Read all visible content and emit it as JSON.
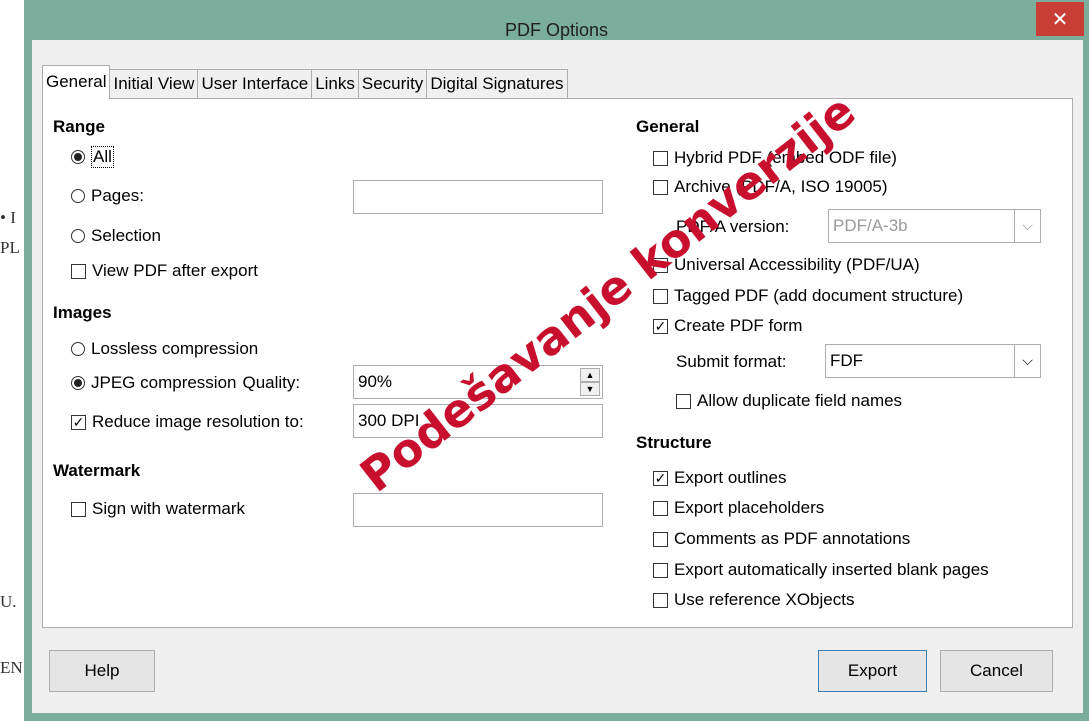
{
  "background_text": [
    "• I",
    "PL",
    "U.",
    "EN"
  ],
  "window": {
    "title": "PDF Options",
    "close_label": "✕"
  },
  "tabs": [
    "General",
    "Initial View",
    "User Interface",
    "Links",
    "Security",
    "Digital Signatures"
  ],
  "left": {
    "range": {
      "title": "Range",
      "all": "All",
      "pages": "Pages:",
      "pages_value": "",
      "selection": "Selection",
      "view_pdf": "View PDF after export"
    },
    "images": {
      "title": "Images",
      "lossless": "Lossless compression",
      "jpeg": "JPEG compression",
      "quality_label": "Quality:",
      "quality_value": "90%",
      "reduce": "Reduce image resolution to:",
      "resolution_value": "300 DPI"
    },
    "watermark": {
      "title": "Watermark",
      "sign": "Sign with watermark",
      "value": ""
    }
  },
  "right": {
    "general": {
      "title": "General",
      "hybrid": "Hybrid PDF (embed ODF file)",
      "archive": "Archive (PDF/A, ISO 19005)",
      "pdfa_label": "PDF/A version:",
      "pdfa_value": "PDF/A-3b",
      "universal": "Universal Accessibility (PDF/UA)",
      "tagged": "Tagged PDF (add document structure)",
      "create_form": "Create PDF form",
      "submit_label": "Submit format:",
      "submit_value": "FDF",
      "allow_duplicate": "Allow duplicate field names"
    },
    "structure": {
      "title": "Structure",
      "outlines": "Export outlines",
      "placeholders": "Export placeholders",
      "comments": "Comments as PDF annotations",
      "blank_pages": "Export automatically inserted blank pages",
      "xobjects": "Use reference XObjects"
    }
  },
  "buttons": {
    "help": "Help",
    "export": "Export",
    "cancel": "Cancel"
  },
  "overlay_text": "Podešavanje konverzije",
  "colors": {
    "title_bar": "#7bad9d",
    "close_button": "#c83d35",
    "overlay": "#c8102e"
  }
}
